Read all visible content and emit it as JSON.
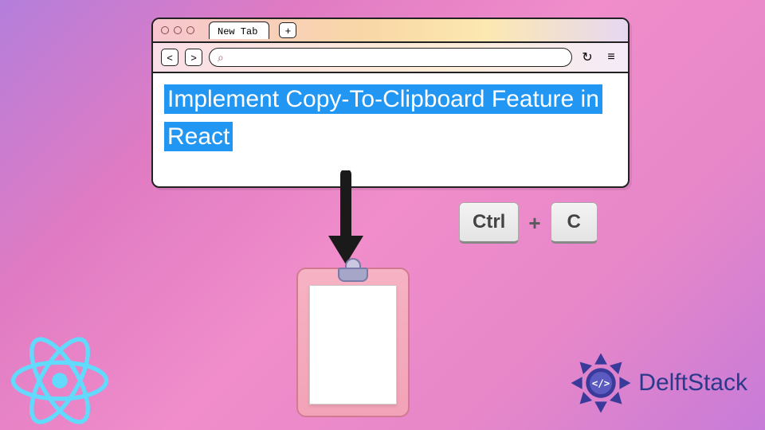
{
  "browser": {
    "tab_label": "New Tab",
    "plus": "+",
    "nav_back": "<",
    "nav_fwd": ">",
    "search_icon_glyph": "⌕",
    "refresh_glyph": "↻",
    "menu_glyph": "≡"
  },
  "content": {
    "highlighted_text": "Implement Copy-To-Clipboard Feature in React"
  },
  "keys": {
    "ctrl": "Ctrl",
    "plus": "+",
    "c": "C"
  },
  "brand": {
    "name": "DelftStack",
    "tag": "</>"
  },
  "colors": {
    "highlight_bg": "#2196f3",
    "react": "#61dafb",
    "delft": "#3a3a9a"
  }
}
